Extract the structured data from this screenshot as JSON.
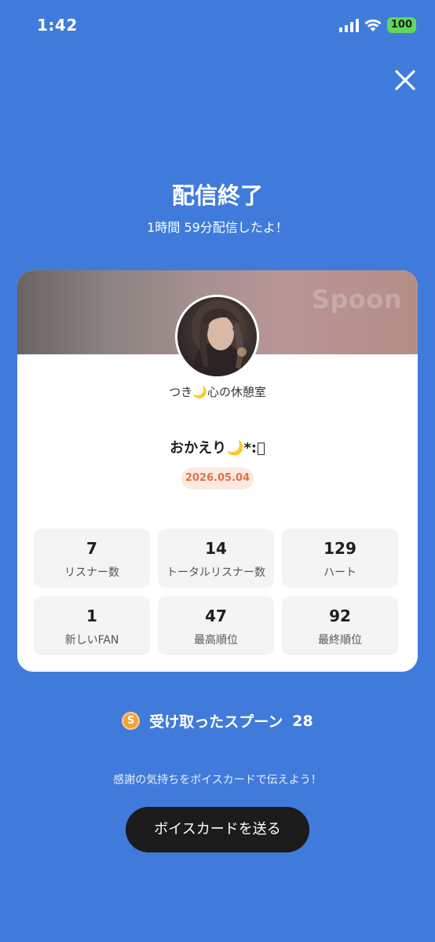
{
  "status_bar": {
    "time": "1:42",
    "battery": "100"
  },
  "header": {
    "title": "配信終了",
    "subtitle": "1時間 59分配信したよ！"
  },
  "card": {
    "brand": "Spoon",
    "dj_name": "つき🌙心の休憩室",
    "cast_title": "おかえり🌙*:ﾟ",
    "date": "2026.05.04",
    "stats": [
      {
        "value": "7",
        "label": "リスナー数"
      },
      {
        "value": "14",
        "label": "トータルリスナー数"
      },
      {
        "value": "129",
        "label": "ハート"
      },
      {
        "value": "1",
        "label": "新しいFAN"
      },
      {
        "value": "47",
        "label": "最高順位"
      },
      {
        "value": "92",
        "label": "最終順位"
      }
    ]
  },
  "spoons": {
    "label": "受け取ったスプーン",
    "count": "28",
    "coin_symbol": "S"
  },
  "thanks_text": "感謝の気持ちをボイスカードで伝えよう！",
  "cta_label": "ボイスカードを送る",
  "colors": {
    "background": "#407bdb",
    "cta": "#1b1b1b",
    "date_badge_text": "#e27345"
  }
}
